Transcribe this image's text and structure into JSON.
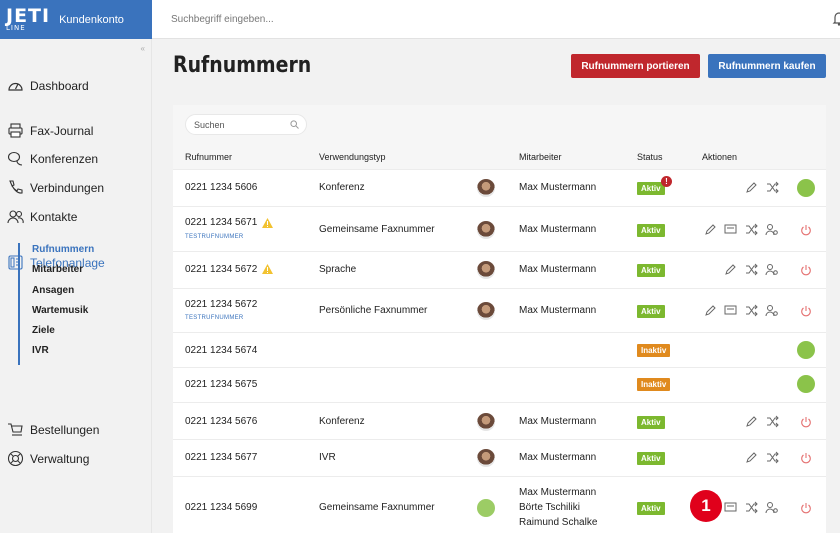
{
  "header": {
    "logo_text": "JETI",
    "logo_sub": "LINE",
    "app_name": "Kundenkonto",
    "search_placeholder": "Suchbegriff eingeben..."
  },
  "sidebar": {
    "collapse": "«",
    "items": [
      {
        "label": "Dashboard",
        "icon": "dashboard-icon"
      },
      {
        "label": "Fax-Journal",
        "icon": "printer-icon"
      },
      {
        "label": "Konferenzen",
        "icon": "conference-icon"
      },
      {
        "label": "Verbindungen",
        "icon": "phone-icon"
      },
      {
        "label": "Kontakte",
        "icon": "contacts-icon"
      },
      {
        "label": "Telefonanlage",
        "icon": "phone-system-icon"
      },
      {
        "label": "Bestellungen",
        "icon": "cart-icon"
      },
      {
        "label": "Verwaltung",
        "icon": "help-icon"
      }
    ],
    "sub_items": [
      "Rufnummern",
      "Mitarbeiter",
      "Ansagen",
      "Wartemusik",
      "Ziele",
      "IVR"
    ]
  },
  "page": {
    "title": "Rufnummern",
    "btn_port": "Rufnummern portieren",
    "btn_buy": "Rufnummern kaufen",
    "filter_placeholder": "Suchen"
  },
  "table": {
    "headers": [
      "Rufnummer",
      "Verwendungstyp",
      "Mitarbeiter",
      "Status",
      "Aktionen"
    ],
    "rows": [
      {
        "number": "0221 1234 5606",
        "test": "",
        "type": "Konferenz",
        "employees": [
          "Max Mustermann"
        ],
        "status": "Aktiv"
      },
      {
        "number": "0221 1234 5671",
        "test": "TESTRUFNUMMER",
        "type": "Gemeinsame Faxnummer",
        "employees": [
          "Max Mustermann"
        ],
        "status": "Aktiv"
      },
      {
        "number": "0221 1234 5672",
        "test": "",
        "type": "Sprache",
        "employees": [
          "Max Mustermann"
        ],
        "status": "Aktiv"
      },
      {
        "number": "0221 1234 5672",
        "test": "TESTRUFNUMMER",
        "type": "Persönliche Faxnummer",
        "employees": [
          "Max Mustermann"
        ],
        "status": "Aktiv"
      },
      {
        "number": "0221 1234 5674",
        "test": "",
        "type": "",
        "employees": [],
        "status": "Inaktiv"
      },
      {
        "number": "0221 1234 5675",
        "test": "",
        "type": "",
        "employees": [],
        "status": "Inaktiv"
      },
      {
        "number": "0221 1234 5676",
        "test": "",
        "type": "Konferenz",
        "employees": [
          "Max Mustermann"
        ],
        "status": "Aktiv"
      },
      {
        "number": "0221 1234 5677",
        "test": "",
        "type": "IVR",
        "employees": [
          "Max Mustermann"
        ],
        "status": "Aktiv"
      },
      {
        "number": "0221 1234 5699",
        "test": "",
        "type": "Gemeinsame Faxnummer",
        "employees": [
          "Max Mustermann",
          "Börte Tschiliki",
          "Raimund Schalke"
        ],
        "status": "Aktiv"
      }
    ],
    "alert_mark": "!",
    "callout": "1"
  },
  "colors": {
    "brand_blue": "#3a73bd",
    "danger_red": "#c0272d",
    "active_green": "#7cb82f",
    "inactive_orange": "#e08a1e"
  }
}
